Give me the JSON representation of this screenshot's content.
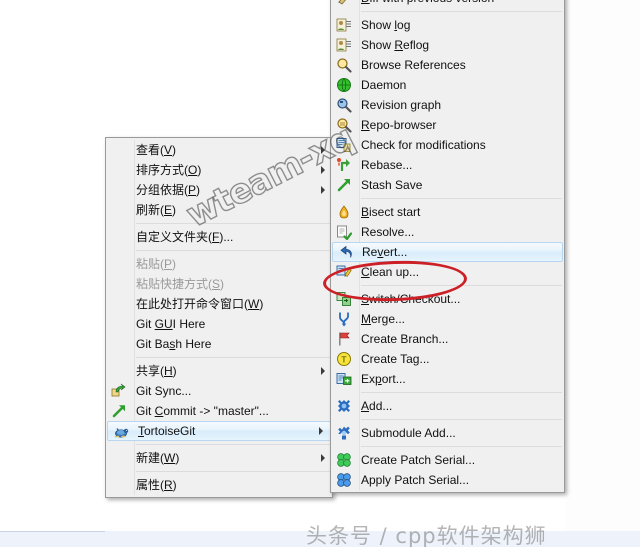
{
  "context_menu": {
    "name": "windows-explorer-context-menu",
    "items": [
      {
        "label": "查看(V)",
        "mnemonic": "V",
        "arrow": true,
        "sep_after": false,
        "icon": null,
        "disabled": false
      },
      {
        "label": "排序方式(O)",
        "mnemonic": "O",
        "arrow": true,
        "sep_after": false,
        "icon": null,
        "disabled": false
      },
      {
        "label": "分组依据(P)",
        "mnemonic": "P",
        "arrow": true,
        "sep_after": false,
        "icon": null,
        "disabled": false
      },
      {
        "label": "刷新(E)",
        "mnemonic": "E",
        "arrow": false,
        "sep_after": true,
        "icon": null,
        "disabled": false
      },
      {
        "label": "自定义文件夹(F)...",
        "mnemonic": "F",
        "arrow": false,
        "sep_after": true,
        "icon": null,
        "disabled": false
      },
      {
        "label": "粘贴(P)",
        "mnemonic": "P",
        "arrow": false,
        "sep_after": false,
        "icon": null,
        "disabled": true
      },
      {
        "label": "粘贴快捷方式(S)",
        "mnemonic": "S",
        "arrow": false,
        "sep_after": false,
        "icon": null,
        "disabled": true
      },
      {
        "label": "在此处打开命令窗口(W)",
        "mnemonic": "W",
        "arrow": false,
        "sep_after": false,
        "icon": null,
        "disabled": false
      },
      {
        "label": "Git GUI Here",
        "mnemonic": "GU",
        "arrow": false,
        "sep_after": false,
        "icon": null,
        "disabled": false
      },
      {
        "label": "Git Bash Here",
        "mnemonic": "s",
        "arrow": false,
        "sep_after": true,
        "icon": null,
        "disabled": false
      },
      {
        "label": "共享(H)",
        "mnemonic": "H",
        "arrow": true,
        "sep_after": false,
        "icon": null,
        "disabled": false
      },
      {
        "label": "Git Sync...",
        "mnemonic": "",
        "arrow": false,
        "sep_after": false,
        "icon": "git-sync-icon",
        "disabled": false
      },
      {
        "label": "Git Commit -> \"master\"...",
        "mnemonic": "C",
        "arrow": false,
        "sep_after": false,
        "icon": "git-commit-icon",
        "disabled": false
      },
      {
        "label": "TortoiseGit",
        "mnemonic": "T",
        "arrow": true,
        "sep_after": true,
        "icon": "tortoisegit-icon",
        "disabled": false,
        "selected": true
      },
      {
        "label": "新建(W)",
        "mnemonic": "W",
        "arrow": true,
        "sep_after": true,
        "icon": null,
        "disabled": false
      },
      {
        "label": "属性(R)",
        "mnemonic": "R",
        "arrow": false,
        "sep_after": false,
        "icon": null,
        "disabled": false
      }
    ]
  },
  "submenu": {
    "name": "tortoisegit-submenu",
    "items": [
      {
        "label": "Diff with previous version",
        "mnemonic": "D",
        "arrow": false,
        "sep_after": true,
        "icon": "diff-icon",
        "disabled": false,
        "clipped_top": true
      },
      {
        "label": "Show log",
        "mnemonic": "l",
        "arrow": false,
        "sep_after": false,
        "icon": "showlog-icon",
        "disabled": false
      },
      {
        "label": "Show Reflog",
        "mnemonic": "R",
        "arrow": false,
        "sep_after": false,
        "icon": "showlog-icon",
        "disabled": false
      },
      {
        "label": "Browse References",
        "mnemonic": "",
        "arrow": false,
        "sep_after": false,
        "icon": "browse-refs-icon",
        "disabled": false
      },
      {
        "label": "Daemon",
        "mnemonic": "",
        "arrow": false,
        "sep_after": false,
        "icon": "daemon-icon",
        "disabled": false
      },
      {
        "label": "Revision graph",
        "mnemonic": "g",
        "arrow": false,
        "sep_after": false,
        "icon": "revgraph-icon",
        "disabled": false
      },
      {
        "label": "Repo-browser",
        "mnemonic": "R",
        "arrow": false,
        "sep_after": false,
        "icon": "repobrowser-icon",
        "disabled": false
      },
      {
        "label": "Check for modifications",
        "mnemonic": "",
        "arrow": false,
        "sep_after": false,
        "icon": "checkmods-icon",
        "disabled": false
      },
      {
        "label": "Rebase...",
        "mnemonic": "",
        "arrow": false,
        "sep_after": false,
        "icon": "rebase-icon",
        "disabled": false
      },
      {
        "label": "Stash Save",
        "mnemonic": "",
        "arrow": false,
        "sep_after": true,
        "icon": "stash-icon",
        "disabled": false
      },
      {
        "label": "Bisect start",
        "mnemonic": "B",
        "arrow": false,
        "sep_after": false,
        "icon": "bisect-icon",
        "disabled": false
      },
      {
        "label": "Resolve...",
        "mnemonic": "",
        "arrow": false,
        "sep_after": false,
        "icon": "resolve-icon",
        "disabled": false
      },
      {
        "label": "Revert...",
        "mnemonic": "v",
        "arrow": false,
        "sep_after": false,
        "icon": "revert-icon",
        "disabled": false,
        "selected": true
      },
      {
        "label": "Clean up...",
        "mnemonic": "C",
        "arrow": false,
        "sep_after": true,
        "icon": "cleanup-icon",
        "disabled": false
      },
      {
        "label": "Switch/Checkout...",
        "mnemonic": "S",
        "arrow": false,
        "sep_after": false,
        "icon": "switch-icon",
        "disabled": false
      },
      {
        "label": "Merge...",
        "mnemonic": "M",
        "arrow": false,
        "sep_after": false,
        "icon": "merge-icon",
        "disabled": false
      },
      {
        "label": "Create Branch...",
        "mnemonic": "",
        "arrow": false,
        "sep_after": false,
        "icon": "branch-icon",
        "disabled": false
      },
      {
        "label": "Create Tag...",
        "mnemonic": "",
        "arrow": false,
        "sep_after": false,
        "icon": "tag-icon",
        "disabled": false
      },
      {
        "label": "Export...",
        "mnemonic": "p",
        "arrow": false,
        "sep_after": true,
        "icon": "export-icon",
        "disabled": false
      },
      {
        "label": "Add...",
        "mnemonic": "A",
        "arrow": false,
        "sep_after": true,
        "icon": "add-icon",
        "disabled": false
      },
      {
        "label": "Submodule Add...",
        "mnemonic": "",
        "arrow": false,
        "sep_after": true,
        "icon": "submodule-icon",
        "disabled": false
      },
      {
        "label": "Create Patch Serial...",
        "mnemonic": "",
        "arrow": false,
        "sep_after": false,
        "icon": "createpatch-icon",
        "disabled": false
      },
      {
        "label": "Apply Patch Serial...",
        "mnemonic": "",
        "arrow": false,
        "sep_after": false,
        "icon": "applypatch-icon",
        "disabled": false
      }
    ]
  },
  "annotation": {
    "highlight_shape": "ellipse",
    "highlight_color": "#cc2026",
    "highlight_target": "Revert..."
  },
  "watermarks": {
    "diagonal": "wteam-xq",
    "bottom": "头条号 / cpp软件架构狮"
  },
  "colors": {
    "menu_background": "#f0f0f0",
    "menu_border": "#9a9a9a",
    "selection_fill": "#d8ecfb",
    "selection_border": "#b8d6ef",
    "text": "#111111",
    "disabled_text": "#9a9a9a",
    "annotation_red": "#cc2026"
  }
}
